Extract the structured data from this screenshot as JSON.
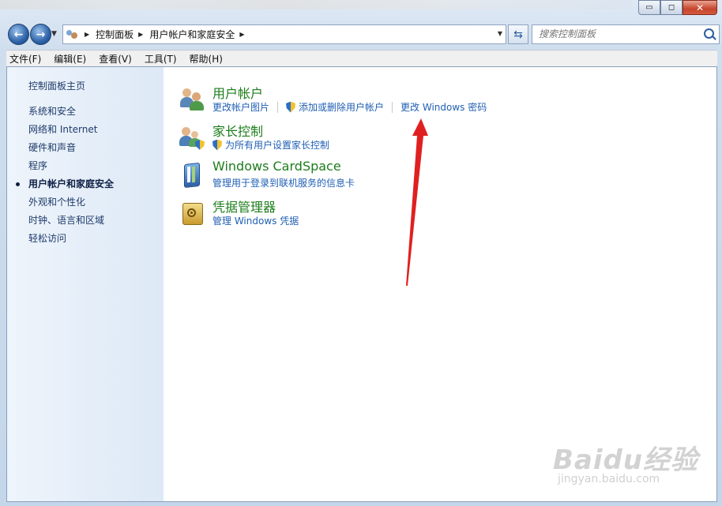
{
  "window": {
    "minimize": "▭",
    "maximize": "◻",
    "close": "✕"
  },
  "nav": {
    "back": "←",
    "forward": "→",
    "breadcrumb": [
      "控制面板",
      "用户帐户和家庭安全"
    ],
    "search_placeholder": "搜索控制面板"
  },
  "menu": [
    "文件(F)",
    "编辑(E)",
    "查看(V)",
    "工具(T)",
    "帮助(H)"
  ],
  "sidebar": {
    "home": "控制面板主页",
    "items": [
      {
        "label": "系统和安全"
      },
      {
        "label": "网络和 Internet"
      },
      {
        "label": "硬件和声音"
      },
      {
        "label": "程序"
      },
      {
        "label": "用户帐户和家庭安全",
        "active": true
      },
      {
        "label": "外观和个性化"
      },
      {
        "label": "时钟、语言和区域"
      },
      {
        "label": "轻松访问"
      }
    ]
  },
  "sections": [
    {
      "title": "用户帐户",
      "icon": "users-icon",
      "links": [
        {
          "label": "更改帐户图片",
          "shield": false
        },
        {
          "label": "添加或删除用户帐户",
          "shield": true
        },
        {
          "label": "更改 Windows 密码",
          "shield": false
        }
      ]
    },
    {
      "title": "家长控制",
      "icon": "parental-controls-icon",
      "links": [
        {
          "label": "为所有用户设置家长控制",
          "shield": true
        }
      ]
    },
    {
      "title": "Windows CardSpace",
      "icon": "cardspace-icon",
      "links": [
        {
          "label": "管理用于登录到联机服务的信息卡",
          "shield": false
        }
      ]
    },
    {
      "title": "凭据管理器",
      "icon": "credential-manager-icon",
      "links": [
        {
          "label": "管理 Windows 凭据",
          "shield": false
        }
      ]
    }
  ],
  "annotation": {
    "color": "#e02020"
  },
  "watermark": {
    "main": "Baidu经验",
    "sub": "jingyan.baidu.com"
  }
}
